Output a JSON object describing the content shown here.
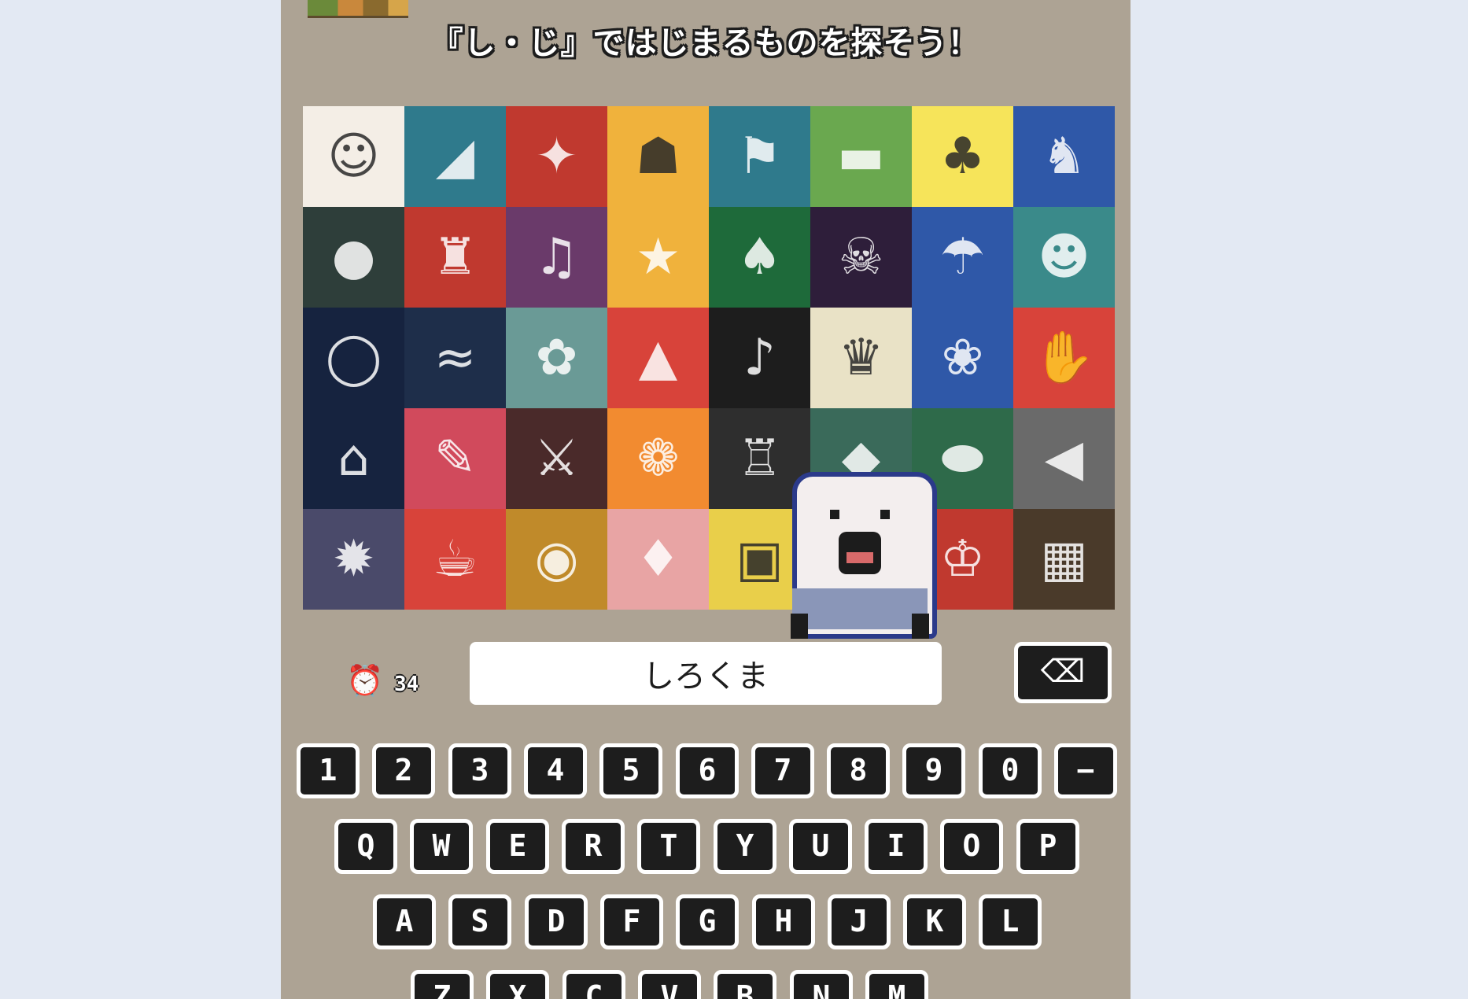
{
  "prompt": "『し・じ』ではじまるものを探そう！",
  "tiles": [
    {
      "name": "tile-face-sketch",
      "bg": "#f4eee6",
      "icon": "☺",
      "dark": true
    },
    {
      "name": "tile-cheesecake",
      "bg": "#2f7a8c",
      "icon": "◢",
      "dark": false
    },
    {
      "name": "tile-dragonfly",
      "bg": "#c0392f",
      "icon": "✦",
      "dark": false
    },
    {
      "name": "tile-robot",
      "bg": "#f0b23c",
      "icon": "☗",
      "dark": true
    },
    {
      "name": "tile-golf-flag",
      "bg": "#2f7a8c",
      "icon": "⚑",
      "dark": false
    },
    {
      "name": "tile-sushi",
      "bg": "#6aa84f",
      "icon": "▬",
      "dark": false
    },
    {
      "name": "tile-clover",
      "bg": "#f6e45a",
      "icon": "♣",
      "dark": true
    },
    {
      "name": "tile-deer",
      "bg": "#2f58a8",
      "icon": "♞",
      "dark": false
    },
    {
      "name": "tile-gorilla",
      "bg": "#2e3e3a",
      "icon": "●",
      "dark": false
    },
    {
      "name": "tile-castle",
      "bg": "#c0392f",
      "icon": "♜",
      "dark": false
    },
    {
      "name": "tile-trumpet",
      "bg": "#6a3a6a",
      "icon": "♫",
      "dark": false
    },
    {
      "name": "tile-star-badge",
      "bg": "#f0b23c",
      "icon": "★",
      "dark": false
    },
    {
      "name": "tile-mushroom",
      "bg": "#1e6a3a",
      "icon": "♠",
      "dark": false
    },
    {
      "name": "tile-demon",
      "bg": "#2e1e3a",
      "icon": "☠",
      "dark": false
    },
    {
      "name": "tile-umbrella",
      "bg": "#2f58a8",
      "icon": "☂",
      "dark": false
    },
    {
      "name": "tile-ghost",
      "bg": "#3a8a8a",
      "icon": "☻",
      "dark": false
    },
    {
      "name": "tile-ring",
      "bg": "#16233f",
      "icon": "◯",
      "dark": false
    },
    {
      "name": "tile-great-wave",
      "bg": "#1e2e4a",
      "icon": "≈",
      "dark": false
    },
    {
      "name": "tile-cherry-tree",
      "bg": "#6a9a96",
      "icon": "✿",
      "dark": false
    },
    {
      "name": "tile-onigiri",
      "bg": "#d8433a",
      "icon": "▲",
      "dark": false
    },
    {
      "name": "tile-music-note",
      "bg": "#1d1d1d",
      "icon": "♪",
      "dark": false
    },
    {
      "name": "tile-trophy",
      "bg": "#e9e2c6",
      "icon": "♛",
      "dark": true
    },
    {
      "name": "tile-flower-pot",
      "bg": "#2f58a8",
      "icon": "❀",
      "dark": false
    },
    {
      "name": "tile-hand",
      "bg": "#d8433a",
      "icon": "✋",
      "dark": false
    },
    {
      "name": "tile-toy-blocks",
      "bg": "#16233f",
      "icon": "⌂",
      "dark": false
    },
    {
      "name": "tile-pencil",
      "bg": "#d14a5c",
      "icon": "✎",
      "dark": false
    },
    {
      "name": "tile-knight",
      "bg": "#4a2a2a",
      "icon": "⚔",
      "dark": false
    },
    {
      "name": "tile-poodle",
      "bg": "#f28b30",
      "icon": "❁",
      "dark": false
    },
    {
      "name": "tile-stone-statue",
      "bg": "#2e2e2e",
      "icon": "♖",
      "dark": false
    },
    {
      "name": "tile-cake",
      "bg": "#3a6a5a",
      "icon": "◆",
      "dark": false
    },
    {
      "name": "tile-rock",
      "bg": "#2e6a4a",
      "icon": "⬬",
      "dark": false
    },
    {
      "name": "tile-arrow",
      "bg": "#6a6a6a",
      "icon": "◀",
      "dark": false
    },
    {
      "name": "tile-gear",
      "bg": "#4a4a6a",
      "icon": "✹",
      "dark": false
    },
    {
      "name": "tile-coffee-cup",
      "bg": "#d8433a",
      "icon": "☕",
      "dark": false
    },
    {
      "name": "tile-omurice",
      "bg": "#c08a2a",
      "icon": "◉",
      "dark": false
    },
    {
      "name": "tile-hedgehog",
      "bg": "#e8a4a4",
      "icon": "♦",
      "dark": false
    },
    {
      "name": "tile-radio",
      "bg": "#e9cf4a",
      "icon": "▣",
      "dark": true
    },
    {
      "name": "tile-hidden-1",
      "bg": "#a0a0a0",
      "icon": "",
      "dark": false
    },
    {
      "name": "tile-pharaoh",
      "bg": "#c0392f",
      "icon": "♔",
      "dark": false
    },
    {
      "name": "tile-brick-wall",
      "bg": "#4a3a2a",
      "icon": "▦",
      "dark": false
    }
  ],
  "timer": {
    "icon": "alarm-clock-icon",
    "value": "34"
  },
  "answer": {
    "value": "しろくま"
  },
  "backspace": {
    "label": "⌫"
  },
  "keyboard": {
    "row1": [
      "1",
      "2",
      "3",
      "4",
      "5",
      "6",
      "7",
      "8",
      "9",
      "0",
      "−"
    ],
    "row2": [
      "Q",
      "W",
      "E",
      "R",
      "T",
      "Y",
      "U",
      "I",
      "O",
      "P"
    ],
    "row3": [
      "A",
      "S",
      "D",
      "F",
      "G",
      "H",
      "J",
      "K",
      "L"
    ],
    "row4": [
      "Z",
      "X",
      "C",
      "V",
      "B",
      "N",
      "M"
    ]
  }
}
